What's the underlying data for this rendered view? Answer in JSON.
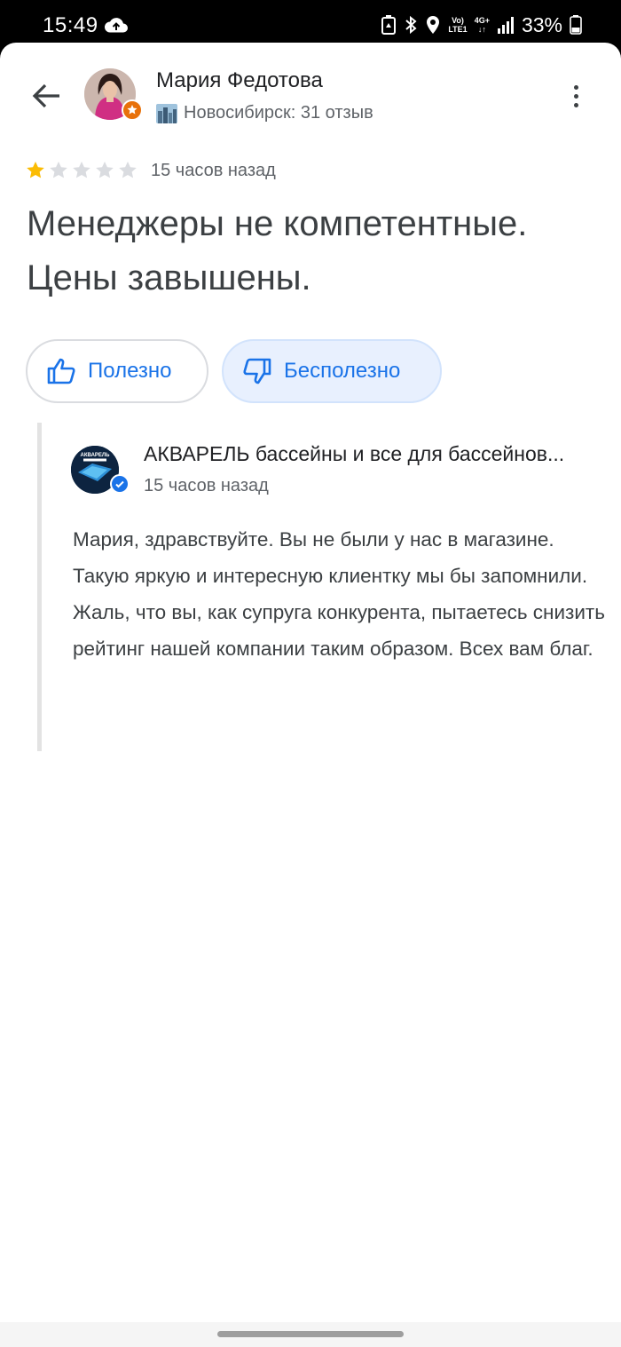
{
  "status_bar": {
    "time": "15:49",
    "battery": "33%",
    "volte": "Vo)\nLTE1",
    "network": "4G+"
  },
  "review": {
    "author": {
      "name": "Мария Федотова",
      "meta": "Новосибирск: 31 отзыв"
    },
    "rating": 1,
    "rating_max": 5,
    "time": "15 часов назад",
    "text": "Менеджеры не компетентные. Цены завышены.",
    "helpful_label": "Полезно",
    "unhelpful_label": "Бесполезно"
  },
  "owner_reply": {
    "name": "АКВАРЕЛЬ бассейны и все для бассейнов...",
    "logo_text": "АКВАРЕЛЬ",
    "time": "15 часов назад",
    "text": "Мария, здравствуйте.  Вы не были у нас в магазине.  Такую яркую и интересную клиентку мы бы запомнили.\nЖаль, что вы, как супруга конкурента, пытаетесь снизить рейтинг нашей компании таким образом.  Всех вам благ."
  },
  "colors": {
    "accent": "#1a73e8",
    "star_filled": "#fbbc04",
    "star_empty": "#dadce0",
    "guide_badge": "#e8710a"
  }
}
